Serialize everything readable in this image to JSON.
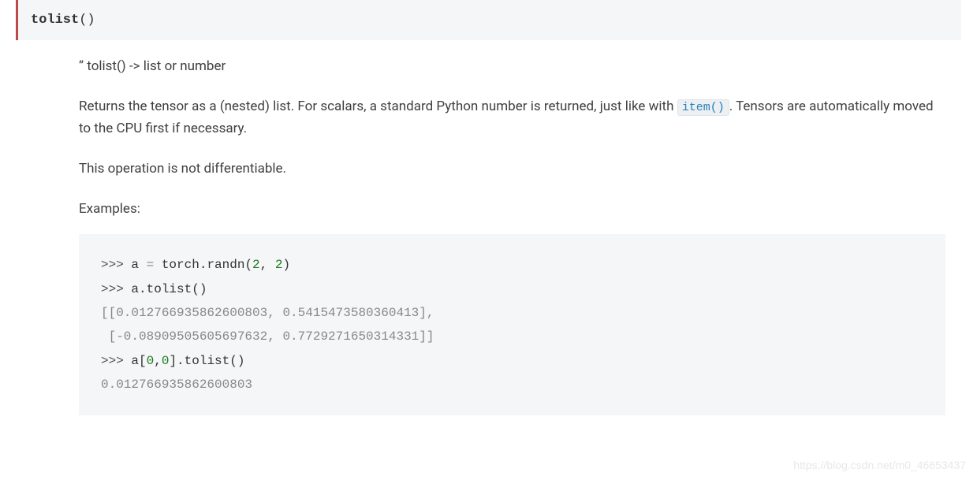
{
  "header": {
    "method_name": "tolist",
    "parens": "()"
  },
  "signature": "” tolist() -> list or number",
  "description": {
    "part1": "Returns the tensor as a (nested) list. For scalars, a standard Python number is returned, just like with ",
    "inline_code": "item()",
    "part2": ". Tensors are automatically moved to the CPU first if necessary."
  },
  "note": "This operation is not differentiable.",
  "examples_label": "Examples:",
  "code": {
    "l1_prompt": ">>> ",
    "l1_var": "a",
    "l1_op": " = ",
    "l1_call": "torch.randn(",
    "l1_arg1": "2",
    "l1_comma": ", ",
    "l1_arg2": "2",
    "l1_close": ")",
    "l2_prompt": ">>> ",
    "l2_expr": "a.tolist()",
    "l3_out": "[[0.012766935862600803, 0.5415473580360413],",
    "l4_out": " [-0.08909505605697632, 0.7729271650314331]]",
    "l5_prompt": ">>> ",
    "l5_var": "a[",
    "l5_i0": "0",
    "l5_comma": ",",
    "l5_i1": "0",
    "l5_close": "].tolist()",
    "l6_out": "0.012766935862600803"
  },
  "watermark": "https://blog.csdn.net/m0_46653437"
}
